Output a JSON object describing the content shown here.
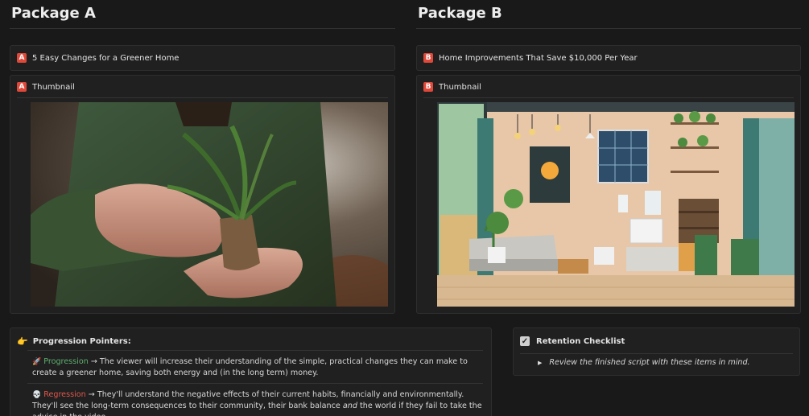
{
  "package_a": {
    "title": "Package A",
    "badge": "A",
    "video_title": "5 Easy Changes for a Greener Home",
    "thumbnail_label": "Thumbnail"
  },
  "package_b": {
    "title": "Package B",
    "badge": "B",
    "video_title": "Home Improvements That Save $10,000 Per Year",
    "thumbnail_label": "Thumbnail"
  },
  "progression": {
    "header_icon": "pointing-hand-icon",
    "header": "Progression Pointers:",
    "progression_icon": "rocket-icon",
    "progression_label": "Progression",
    "progression_text": " → The viewer will increase their understanding of the simple, practical changes they can make to create a greener home, saving both energy and (in the long term) money.",
    "regression_icon": "skull-icon",
    "regression_label": "Regression",
    "regression_text_1": " → They'll understand the negative effects of their current habits, financially and environmentally. They'll see the long-term consequences to their community, their bank balance ",
    "regression_text_and": "and",
    "regression_text_2": " the world if they fail to take the advice in the video."
  },
  "retention": {
    "header": "Retention Checklist",
    "item": "Review the finished script with these items in mind."
  },
  "colors": {
    "badge_red": "#e0483a",
    "progression_green": "#5fae6e",
    "regression_red": "#e0574b",
    "background": "#191919"
  }
}
